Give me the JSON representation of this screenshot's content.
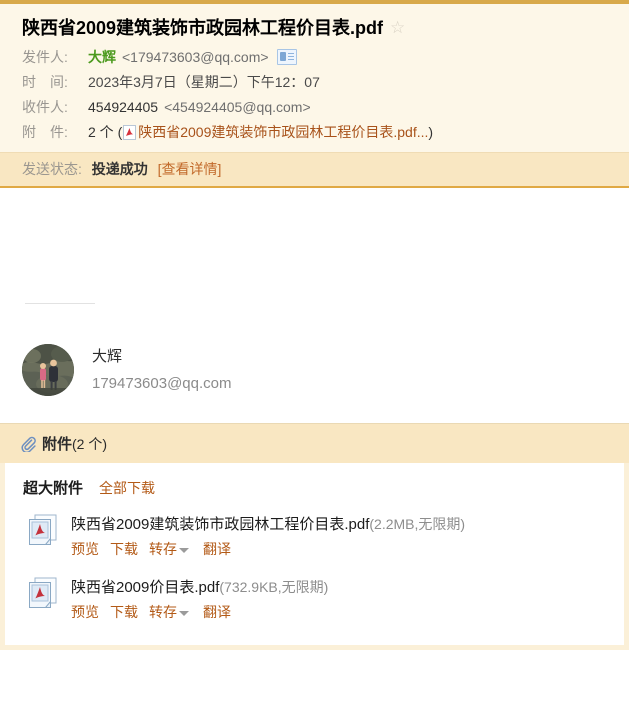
{
  "colors": {
    "top_rule": "#d8a94a",
    "header_bg": "#fdf7e8",
    "status_bg": "#f9e7c2",
    "status_border": "#e0a944",
    "link": "#b35a17",
    "sender_green": "#4c9a1e"
  },
  "header": {
    "subject": "陕西省2009建筑装饰市政园林工程价目表.pdf",
    "star_glyph": "☆",
    "rows": {
      "from_label": "发件人:",
      "from_name": "大辉",
      "from_address": "<179473603@qq.com>",
      "time_label": "时　间:",
      "time_value": "2023年3月7日（星期二）下午12：07",
      "to_label": "收件人:",
      "to_name": "454924405",
      "to_address": "<454924405@qq.com>",
      "att_label": "附　件:",
      "att_count": "2 个 (",
      "att_first_name": "陕西省2009建筑装饰市政园林工程价目表.pdf...",
      "att_close": ")"
    }
  },
  "status": {
    "label": "发送状态:",
    "value": "投递成功",
    "detail_link": "[查看详情]"
  },
  "signature": {
    "name": "大辉",
    "email": "179473603@qq.com"
  },
  "attachments": {
    "header_title": "附件",
    "header_count": "(2 个)",
    "group_title": "超大附件",
    "download_all": "全部下载",
    "actions": {
      "preview": "预览",
      "download": "下载",
      "save": "转存",
      "translate": "翻译"
    },
    "items": [
      {
        "name": "陕西省2009建筑装饰市政园林工程价目表.pdf",
        "size": "(2.2MB,无限期)"
      },
      {
        "name": "陕西省2009价目表.pdf",
        "size": "(732.9KB,无限期)"
      }
    ]
  }
}
